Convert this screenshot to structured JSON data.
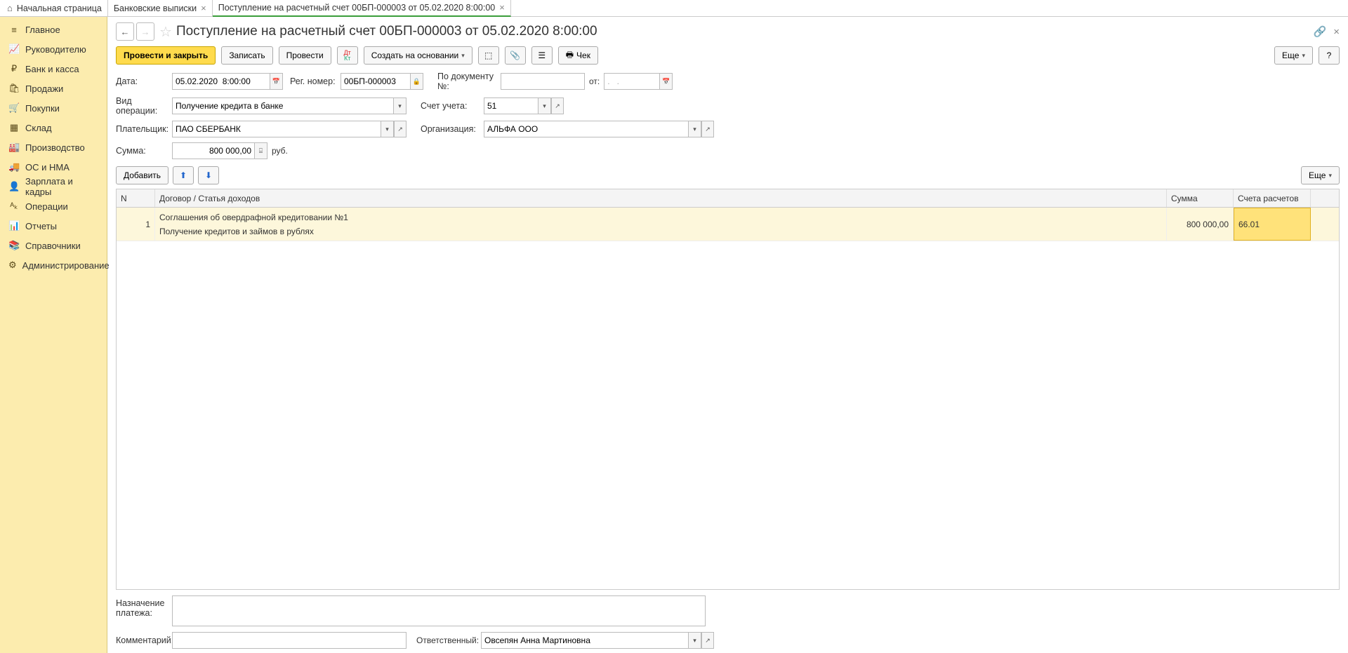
{
  "tabs": {
    "home": "Начальная страница",
    "bank": "Банковские выписки",
    "current": "Поступление на расчетный счет 00БП-000003 от 05.02.2020 8:00:00"
  },
  "sidebar": [
    {
      "icon": "≡",
      "label": "Главное"
    },
    {
      "icon": "📈",
      "label": "Руководителю"
    },
    {
      "icon": "₽",
      "label": "Банк и касса"
    },
    {
      "icon": "🛍",
      "label": "Продажи"
    },
    {
      "icon": "🛒",
      "label": "Покупки"
    },
    {
      "icon": "▦",
      "label": "Склад"
    },
    {
      "icon": "🏭",
      "label": "Производство"
    },
    {
      "icon": "🚚",
      "label": "ОС и НМА"
    },
    {
      "icon": "👤",
      "label": "Зарплата и кадры"
    },
    {
      "icon": "ᴬₖ",
      "label": "Операции"
    },
    {
      "icon": "📊",
      "label": "Отчеты"
    },
    {
      "icon": "📚",
      "label": "Справочники"
    },
    {
      "icon": "⚙",
      "label": "Администрирование"
    }
  ],
  "page_title": "Поступление на расчетный счет 00БП-000003 от 05.02.2020 8:00:00",
  "toolbar": {
    "post_close": "Провести и закрыть",
    "save": "Записать",
    "post": "Провести",
    "create_from": "Создать на основании",
    "check": "Чек",
    "more": "Еще"
  },
  "form": {
    "date_label": "Дата:",
    "date_value": "05.02.2020  8:00:00",
    "regnum_label": "Рег. номер:",
    "regnum_value": "00БП-000003",
    "docnum_label": "По документу №:",
    "docnum_value": "",
    "from_label": "от:",
    "from_value": ".   .",
    "optype_label": "Вид операции:",
    "optype_value": "Получение кредита в банке",
    "account_label": "Счет учета:",
    "account_value": "51",
    "payer_label": "Плательщик:",
    "payer_value": "ПАО СБЕРБАНК",
    "org_label": "Организация:",
    "org_value": "АЛЬФА ООО",
    "sum_label": "Сумма:",
    "sum_value": "800 000,00",
    "currency": "руб."
  },
  "table_toolbar": {
    "add": "Добавить",
    "more": "Еще"
  },
  "table": {
    "headers": {
      "n": "N",
      "desc": "Договор / Статья доходов",
      "sum": "Сумма",
      "acct": "Счета расчетов"
    },
    "rows": [
      {
        "n": "1",
        "line1": "Соглашения об овердрафной кредитовании №1",
        "line2": "Получение кредитов и займов в рублях",
        "sum": "800 000,00",
        "acct": "66.01"
      }
    ]
  },
  "bottom": {
    "purpose_label1": "Назначение",
    "purpose_label2": "платежа:",
    "comment_label": "Комментарий:",
    "responsible_label": "Ответственный:",
    "responsible_value": "Овсепян Анна Мартиновна"
  },
  "help": "?"
}
